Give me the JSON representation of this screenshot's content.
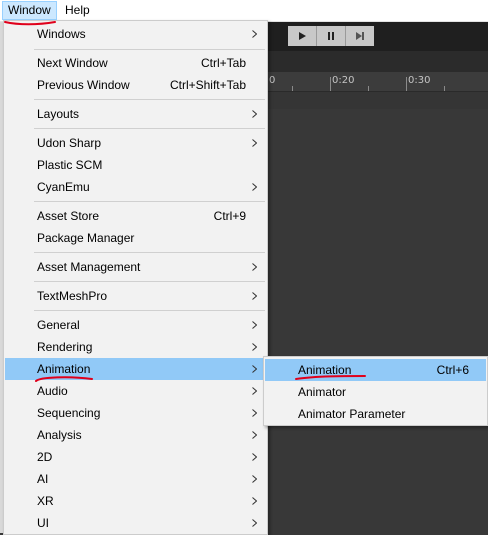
{
  "menubar": {
    "items": [
      {
        "label": "Window"
      },
      {
        "label": "Help"
      }
    ]
  },
  "timeline": {
    "ruler_labels": [
      "0",
      "0:20",
      "0:30"
    ]
  },
  "window_menu": {
    "items": [
      {
        "label": "Windows",
        "shortcut": ""
      },
      {
        "label": "Next Window",
        "shortcut": "Ctrl+Tab"
      },
      {
        "label": "Previous Window",
        "shortcut": "Ctrl+Shift+Tab"
      },
      {
        "label": "Layouts",
        "shortcut": ""
      },
      {
        "label": "Udon Sharp",
        "shortcut": ""
      },
      {
        "label": "Plastic SCM",
        "shortcut": ""
      },
      {
        "label": "CyanEmu",
        "shortcut": ""
      },
      {
        "label": "Asset Store",
        "shortcut": "Ctrl+9"
      },
      {
        "label": "Package Manager",
        "shortcut": ""
      },
      {
        "label": "Asset Management",
        "shortcut": ""
      },
      {
        "label": "TextMeshPro",
        "shortcut": ""
      },
      {
        "label": "General",
        "shortcut": ""
      },
      {
        "label": "Rendering",
        "shortcut": ""
      },
      {
        "label": "Animation",
        "shortcut": ""
      },
      {
        "label": "Audio",
        "shortcut": ""
      },
      {
        "label": "Sequencing",
        "shortcut": ""
      },
      {
        "label": "Analysis",
        "shortcut": ""
      },
      {
        "label": "2D",
        "shortcut": ""
      },
      {
        "label": "AI",
        "shortcut": ""
      },
      {
        "label": "XR",
        "shortcut": ""
      },
      {
        "label": "UI",
        "shortcut": ""
      }
    ]
  },
  "animation_submenu": {
    "items": [
      {
        "label": "Animation",
        "shortcut": "Ctrl+6"
      },
      {
        "label": "Animator",
        "shortcut": ""
      },
      {
        "label": "Animator Parameter",
        "shortcut": ""
      }
    ]
  },
  "colors": {
    "highlight": "#91c9f7",
    "menubar_active": "#cce8ff",
    "annotation": "#e0001b"
  }
}
